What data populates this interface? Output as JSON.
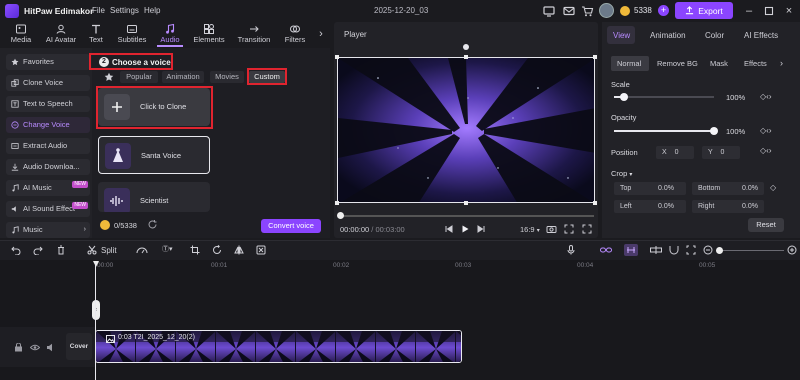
{
  "app": {
    "name": "HitPaw Edimakor",
    "menus": [
      "File",
      "Settings",
      "Help"
    ],
    "project_title": "2025-12-20_03",
    "credits": "5338",
    "export_label": "Export"
  },
  "tool_tabs": [
    {
      "label": "Media",
      "icon": "media-icon"
    },
    {
      "label": "AI Avatar",
      "icon": "avatar-icon"
    },
    {
      "label": "Text",
      "icon": "text-icon"
    },
    {
      "label": "Subtitles",
      "icon": "subtitles-icon"
    },
    {
      "label": "Audio",
      "icon": "audio-icon",
      "active": true
    },
    {
      "label": "Elements",
      "icon": "elements-icon"
    },
    {
      "label": "Transition",
      "icon": "transition-icon"
    },
    {
      "label": "Filters",
      "icon": "filters-icon"
    }
  ],
  "sidebar": {
    "items": [
      {
        "label": "Favorites",
        "icon": "star-icon"
      },
      {
        "label": "Clone Voice",
        "icon": "clone-icon"
      },
      {
        "label": "Text to Speech",
        "icon": "tts-icon"
      },
      {
        "label": "Change Voice",
        "icon": "change-voice-icon",
        "active": true
      },
      {
        "label": "Extract Audio",
        "icon": "extract-icon"
      },
      {
        "label": "Audio Downloa...",
        "icon": "download-icon"
      },
      {
        "label": "AI Music",
        "icon": "music-icon",
        "badge": "NEW"
      },
      {
        "label": "AI Sound Effect",
        "icon": "sound-effect-icon",
        "badge": "NEW"
      },
      {
        "label": "Music",
        "icon": "music-note-icon"
      }
    ]
  },
  "voice_panel": {
    "step_number": "2",
    "title": "Choose a voice",
    "subtabs": [
      "Popular",
      "Animation",
      "Movies",
      "Custom"
    ],
    "active_subtab": "Custom",
    "cards": [
      {
        "label": "Click to Clone"
      },
      {
        "label": "Santa Voice"
      },
      {
        "label": "Scientist"
      }
    ],
    "usage": "0/5338",
    "convert_label": "Convert voice"
  },
  "player": {
    "title": "Player",
    "current_time": "00:00:00",
    "separator": "/",
    "total_time": "00:03:00",
    "aspect_ratio": "16:9"
  },
  "right_panel": {
    "tabs": [
      "View",
      "Animation",
      "Color",
      "AI Effects"
    ],
    "active_tab": "View",
    "subtabs": [
      "Normal",
      "Remove BG",
      "Mask",
      "Effects"
    ],
    "scale_label": "Scale",
    "scale_value": "100%",
    "scale_level": 0.1,
    "opacity_label": "Opacity",
    "opacity_value": "100%",
    "opacity_level": 1.0,
    "position_label": "Position",
    "pos_x_label": "X",
    "pos_x_value": "0",
    "pos_y_label": "Y",
    "pos_y_value": "0",
    "crop_label": "Crop",
    "crop_top_label": "Top",
    "crop_top_value": "0.0%",
    "crop_bottom_label": "Bottom",
    "crop_bottom_value": "0.0%",
    "crop_left_label": "Left",
    "crop_left_value": "0.0%",
    "crop_right_label": "Right",
    "crop_right_value": "0.0%",
    "reset_label": "Reset"
  },
  "timeline": {
    "split_label": "Split",
    "ticks": [
      "00:00",
      "00:01",
      "00:02",
      "00:03",
      "00:04",
      "00:05"
    ],
    "cover_label": "Cover",
    "clip_duration": "0:03",
    "clip_name": "T2I_2025_12_20(2)"
  },
  "colors": {
    "accent": "#8b45ff",
    "highlight_red": "#e0242f",
    "panel": "#222227"
  }
}
